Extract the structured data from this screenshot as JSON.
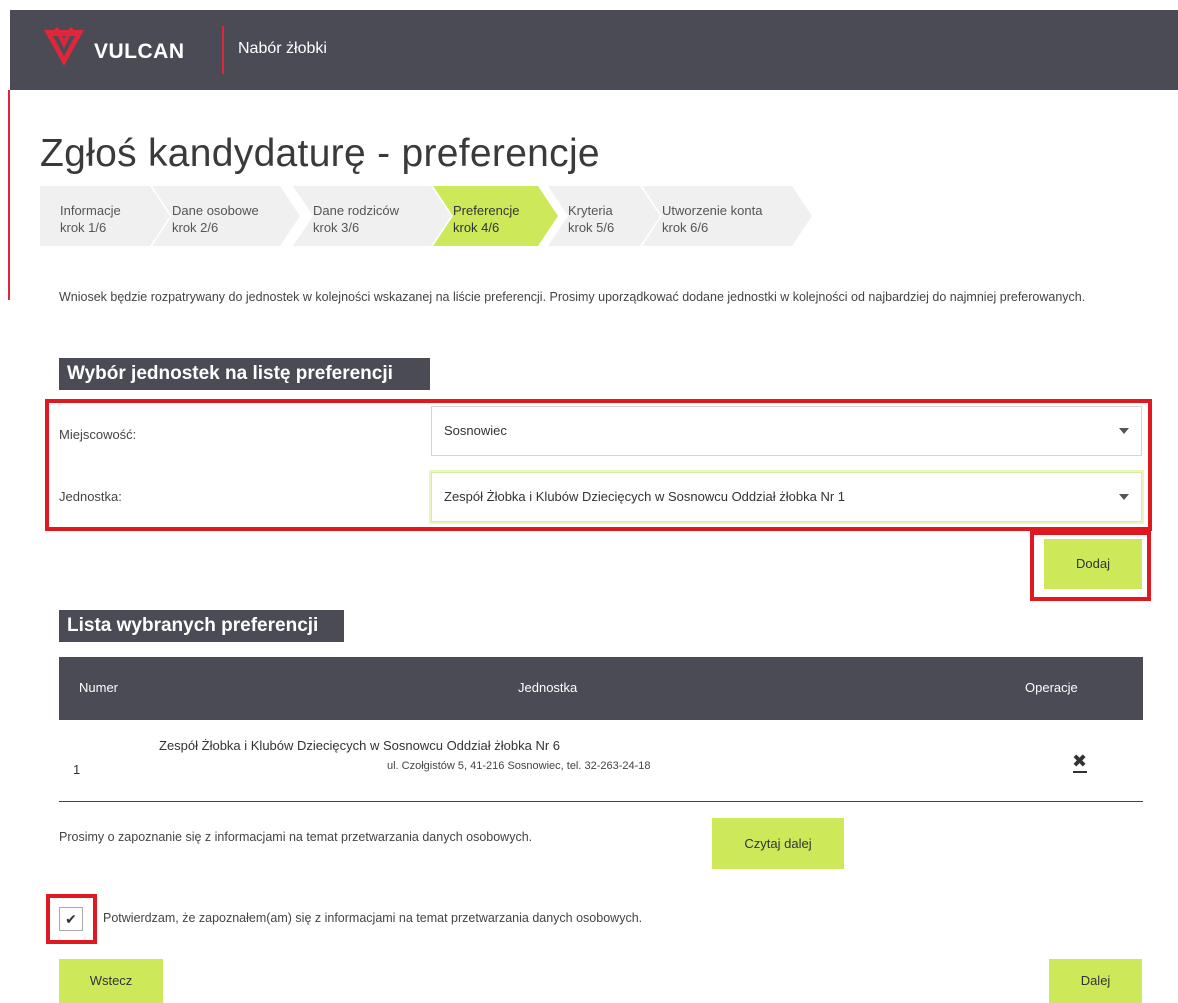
{
  "header": {
    "logo_text": "VULCAN",
    "app_title": "Nabór żłobki"
  },
  "page": {
    "title": "Zgłoś kandydaturę - preferencje"
  },
  "steps": [
    {
      "name": "Informacje",
      "step": "krok 1/6",
      "state": "done"
    },
    {
      "name": "Dane osobowe",
      "step": "krok 2/6",
      "state": "done"
    },
    {
      "name": "Dane rodziców",
      "step": "krok 3/6",
      "state": "done"
    },
    {
      "name": "Preferencje",
      "step": "krok 4/6",
      "state": "active"
    },
    {
      "name": "Kryteria",
      "step": "krok 5/6",
      "state": "todo"
    },
    {
      "name": "Utworzenie konta",
      "step": "krok 6/6",
      "state": "todo"
    }
  ],
  "intro": "Wniosek będzie rozpatrywany do jednostek w kolejności wskazanej na liście preferencji. Prosimy uporządkować dodane jednostki w kolejności od najbardziej do najmniej preferowanych.",
  "selection": {
    "heading": "Wybór jednostek na listę preferencji",
    "city_label": "Miejscowość:",
    "city_value": "Sosnowiec",
    "unit_label": "Jednostka:",
    "unit_value": "Zespół Żłobka i Klubów Dziecięcych w Sosnowcu Oddział żłobka Nr 1",
    "add_button": "Dodaj"
  },
  "preferences": {
    "heading": "Lista wybranych preferencji",
    "columns": [
      "Numer",
      "Jednostka",
      "Operacje"
    ],
    "rows": [
      {
        "number": "1",
        "name": "Zespół Żłobka i Klubów Dziecięcych w Sosnowcu Oddział żłobka Nr 6",
        "address": "ul. Czołgistów 5, 41-216 Sosnowiec, tel. 32-263-24-18",
        "remove_icon": "close-icon"
      }
    ]
  },
  "privacy": {
    "text": "Prosimy o zapoznanie się z informacjami na temat przetwarzania danych osobowych.",
    "read_more": "Czytaj dalej",
    "confirm_checked": true,
    "confirm_text": "Potwierdzam, że zapoznałem(am) się z informacjami na temat przetwarzania danych osobowych."
  },
  "nav": {
    "back": "Wstecz",
    "next": "Dalej"
  },
  "colors": {
    "header_bg": "#4a4b55",
    "accent_green": "#cde95a",
    "brand_red": "#e0263a",
    "highlight_red": "#e0181f",
    "step_inactive": "#f0f0f0"
  }
}
